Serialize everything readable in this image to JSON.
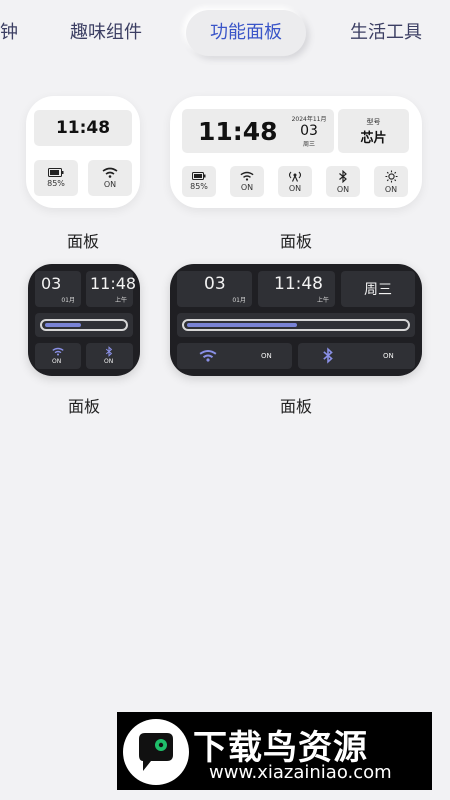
{
  "tabs": [
    {
      "label": "钟"
    },
    {
      "label": "趣味组件"
    },
    {
      "label": "功能面板"
    },
    {
      "label": "生活工具"
    }
  ],
  "light_small": {
    "time": "11:48",
    "battery": "85%",
    "wifi": "ON",
    "label": "面板"
  },
  "light_large": {
    "time": "11:48",
    "date_header": "2024年11月",
    "day": "03",
    "weekday": "周三",
    "model_label": "型号",
    "chip_label": "芯片",
    "battery": "85%",
    "toggles": [
      "ON",
      "ON",
      "ON",
      "ON"
    ],
    "label": "面板"
  },
  "dark_small": {
    "day": "03",
    "month": "01月",
    "time": "11:48",
    "ampm": "上午",
    "wifi": "ON",
    "bluetooth": "ON",
    "slider_level": 0.45,
    "label": "面板"
  },
  "dark_large": {
    "day": "03",
    "month": "01月",
    "time": "11:48",
    "ampm": "上午",
    "weekday": "周三",
    "wifi": "ON",
    "bluetooth": "ON",
    "slider_level": 0.5,
    "label": "面板"
  },
  "banner": {
    "title": "下载鸟资源",
    "url": "www.xiazainiao.com"
  },
  "colors": {
    "accent": "#3a55c8",
    "slider_fill": "#7a84d6",
    "dark_bg": "#1f1f23",
    "background": "#f2f2f4"
  }
}
